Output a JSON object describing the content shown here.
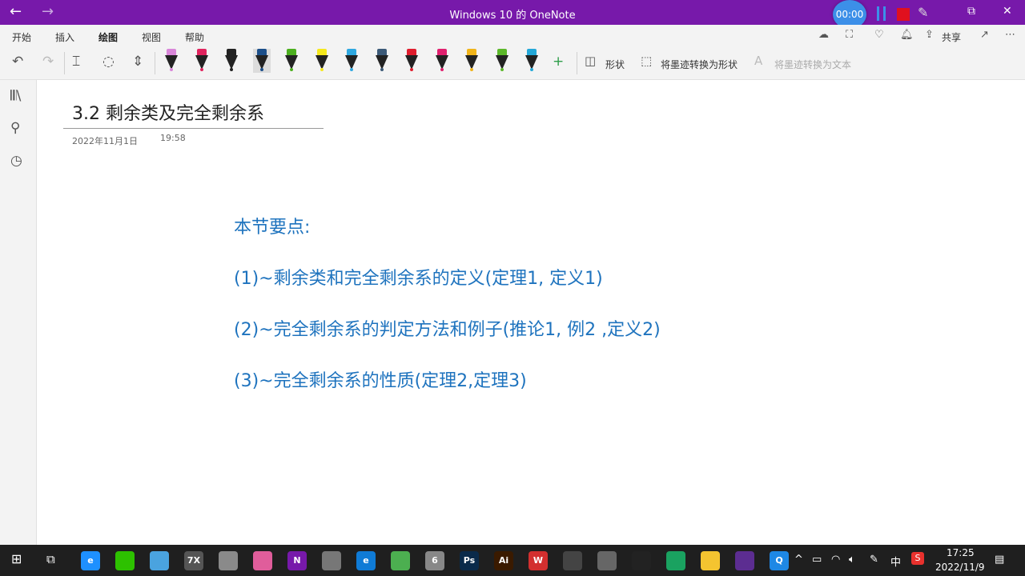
{
  "window": {
    "title": "Windows 10 的 OneNote",
    "back": "←",
    "forward": "→",
    "minimize": "—",
    "restore": "⧉",
    "close": "✕"
  },
  "recorder": {
    "timer": "00:00"
  },
  "ribbon": {
    "tabs": [
      {
        "label": "开始"
      },
      {
        "label": "插入"
      },
      {
        "label": "绘图",
        "active": true
      },
      {
        "label": "视图"
      },
      {
        "label": "帮助"
      }
    ],
    "share_label": "共享"
  },
  "toolbar": {
    "shapes_label": "形状",
    "ink_to_shape_label": "将墨迹转换为形状",
    "ink_to_text_label": "将墨迹转换为文本",
    "pens": [
      {
        "cap": "#d986d9",
        "tip": "#d986d9"
      },
      {
        "cap": "#e0245e",
        "tip": "#e0245e"
      },
      {
        "cap": "#222222",
        "tip": "#222222"
      },
      {
        "cap": "#1c4f8a",
        "tip": "#1c4f8a",
        "selected": true
      },
      {
        "cap": "#4caf1f",
        "tip": "#4caf1f"
      },
      {
        "cap": "#f5e81c",
        "tip": "#f5e81c"
      },
      {
        "cap": "#2fa8e0",
        "tip": "#2fa8e0"
      },
      {
        "cap": "#3c5a78",
        "tip": "#3c5a78"
      },
      {
        "cap": "#e01e2e",
        "tip": "#e01e2e"
      },
      {
        "cap": "#e0206e",
        "tip": "#e0206e"
      },
      {
        "cap": "#f0b419",
        "tip": "#f0b419"
      },
      {
        "cap": "#5cb82a",
        "tip": "#5cb82a"
      },
      {
        "cap": "#24a8d8",
        "tip": "#24a8d8"
      }
    ]
  },
  "page": {
    "title": "3.2 剩余类及完全剩余系",
    "date": "2022年11月1日",
    "time": "19:58",
    "notes": [
      "本节要点:",
      "(1)~剩余类和完全剩余系的定义(定理1, 定义1)",
      "(2)~完全剩余系的判定方法和例子(推论1, 例2 ,定义2)",
      "(3)~完全剩余系的性质(定理2,定理3)"
    ]
  },
  "taskbar": {
    "apps": [
      {
        "name": "edge-app",
        "color": "#1e90ff",
        "text": "e"
      },
      {
        "name": "wechat-app",
        "color": "#2dc100",
        "text": ""
      },
      {
        "name": "browser-app",
        "color": "#4aa3df",
        "text": ""
      },
      {
        "name": "7zip-app",
        "color": "#555555",
        "text": "7X"
      },
      {
        "name": "paint-app",
        "color": "#8a8a8a",
        "text": ""
      },
      {
        "name": "toolbox-app",
        "color": "#e05d9b",
        "text": ""
      },
      {
        "name": "onenote-app",
        "color": "#7719aa",
        "text": "N"
      },
      {
        "name": "monitor-app",
        "color": "#777777",
        "text": ""
      },
      {
        "name": "edge2-app",
        "color": "#0f7bd6",
        "text": "e"
      },
      {
        "name": "flower-app",
        "color": "#4caf50",
        "text": ""
      },
      {
        "name": "matlab-app",
        "color": "#888888",
        "text": "6"
      },
      {
        "name": "photoshop-app",
        "color": "#0a2a4a",
        "text": "Ps"
      },
      {
        "name": "illustrator-app",
        "color": "#3a1a00",
        "text": "Ai"
      },
      {
        "name": "wps-app",
        "color": "#d32f2f",
        "text": "W"
      },
      {
        "name": "film-app",
        "color": "#444444",
        "text": ""
      },
      {
        "name": "settings-app",
        "color": "#666666",
        "text": ""
      },
      {
        "name": "qq-app",
        "color": "#222222",
        "text": ""
      },
      {
        "name": "sheets-app",
        "color": "#1aa260",
        "text": ""
      },
      {
        "name": "explorer-app",
        "color": "#f4c430",
        "text": ""
      },
      {
        "name": "vs-app",
        "color": "#5c2d91",
        "text": ""
      },
      {
        "name": "search-app",
        "color": "#1e88e5",
        "text": "Q"
      }
    ],
    "ime": "中",
    "time": "17:25",
    "date": "2022/11/9"
  }
}
